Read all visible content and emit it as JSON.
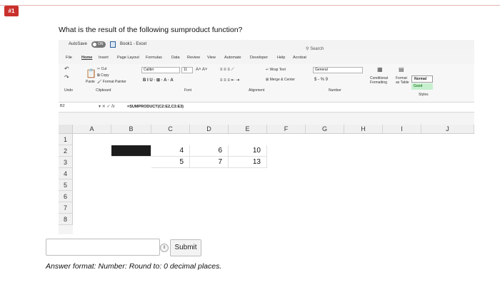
{
  "question_number": "#1",
  "question": "What is the result of the following sumproduct function?",
  "excel": {
    "autosave_label": "AutoSave",
    "autosave_state": "ON",
    "window_title": "Book1 - Excel",
    "search": "Search",
    "menu": [
      "File",
      "Home",
      "Insert",
      "Page Layout",
      "Formulas",
      "Data",
      "Review",
      "View",
      "Automate",
      "Developer",
      "Help",
      "Acrobat"
    ],
    "ribbon": {
      "cut": "Cut",
      "copy": "Copy",
      "paste": "Paste",
      "format_painter": "Format Painter",
      "undo": "Undo",
      "clipboard": "Clipboard",
      "font_name": "Calibri",
      "font_size": "11",
      "font_group": "Font",
      "wrap_text": "Wrap Text",
      "merge_center": "Merge & Center",
      "alignment": "Alignment",
      "number_format": "General",
      "number_group": "Number",
      "number_symbols": "$ - % 9",
      "conditional_formatting": "Conditional Formatting",
      "format_as_table": "Format as Table",
      "style_normal": "Normal",
      "style_good": "Good",
      "styles": "Styles"
    },
    "name_box": "B2",
    "fx": "fx",
    "formula": "=SUMPRODUCT(C2:E2,C3:E3)",
    "columns": [
      "A",
      "B",
      "C",
      "D",
      "E",
      "F",
      "G",
      "H",
      "I",
      "J"
    ],
    "rows": [
      "1",
      "2",
      "3",
      "4",
      "5",
      "6",
      "7",
      "8"
    ],
    "cells": {
      "C2": "4",
      "D2": "6",
      "E2": "10",
      "C3": "5",
      "D3": "7",
      "E3": "13"
    }
  },
  "answer": {
    "value": "",
    "stepper_icon": "up-down-icon",
    "submit_label": "Submit",
    "format_hint": "Answer format: Number: Round to: 0 decimal places."
  }
}
